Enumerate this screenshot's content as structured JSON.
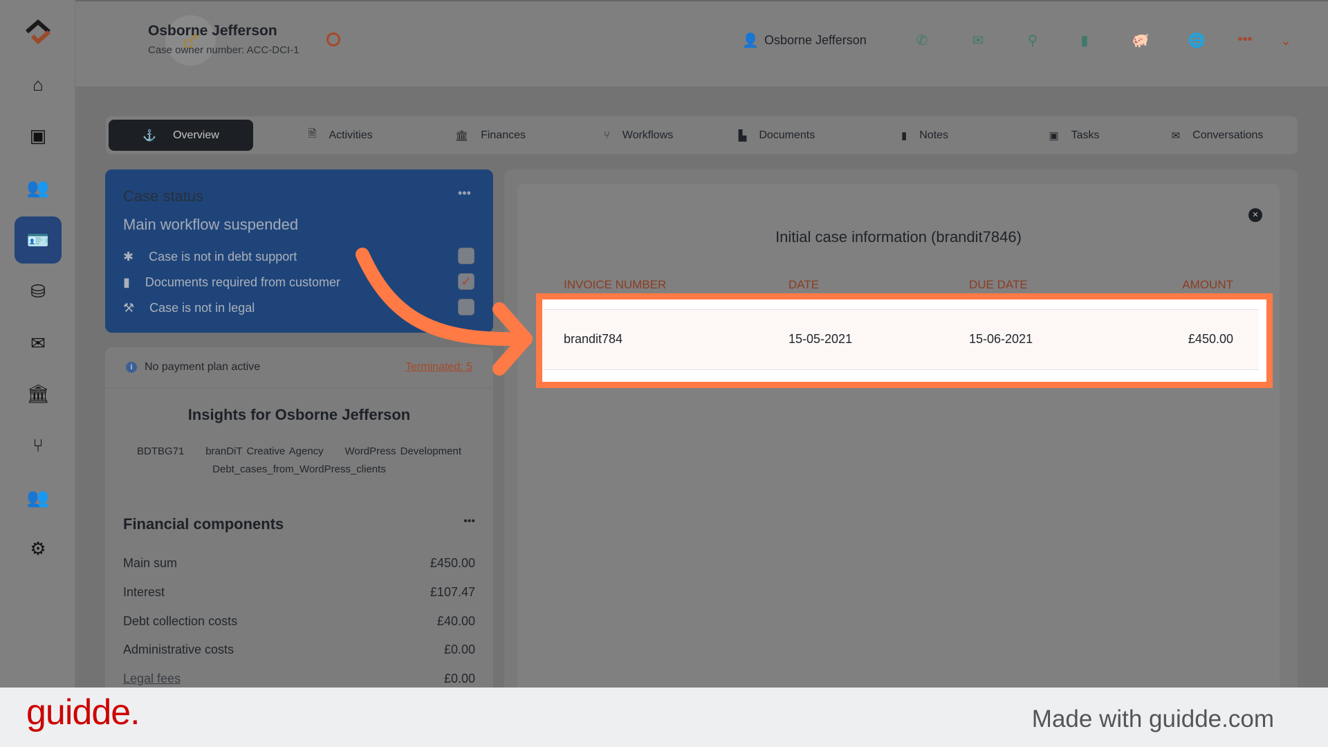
{
  "header": {
    "name": "Osborne Jefferson",
    "case_owner": "Case owner number: ACC-DCI-1",
    "contact_name": "Osborne Jefferson",
    "icons": [
      "phone-icon",
      "envelope-icon",
      "map-pin-icon",
      "mobile-icon",
      "piggy-bank-icon",
      "globe-icon",
      "more-icon",
      "chevron-down-icon"
    ]
  },
  "sidebar": {
    "items": [
      "logo",
      "home",
      "tasks",
      "users",
      "contact-card",
      "database",
      "mail",
      "bank",
      "workflow",
      "user-settings",
      "settings"
    ],
    "active": "contact-card"
  },
  "tabs": [
    {
      "label": "Overview",
      "icon": "anchor-icon"
    },
    {
      "label": "Activities",
      "icon": "file-search-icon"
    },
    {
      "label": "Finances",
      "icon": "bank-icon"
    },
    {
      "label": "Workflows",
      "icon": "branch-icon"
    },
    {
      "label": "Documents",
      "icon": "folder-icon"
    },
    {
      "label": "Notes",
      "icon": "clipboard-icon"
    },
    {
      "label": "Tasks",
      "icon": "ticket-icon"
    },
    {
      "label": "Conversations",
      "icon": "envelope-icon"
    }
  ],
  "case_status": {
    "title": "Case status",
    "subtitle": "Main workflow suspended",
    "items": [
      {
        "label": "Case is not in debt support",
        "checked": false
      },
      {
        "label": "Documents required from customer",
        "checked": true
      },
      {
        "label": "Case is not in legal",
        "checked": false
      }
    ]
  },
  "payment": {
    "text": "No payment plan active",
    "link": "Terminated: 5"
  },
  "insights": {
    "title": "Insights for Osborne Jefferson",
    "tags": [
      "BDTBG71",
      "branDiT Creative Agency",
      "WordPress Development",
      "Debt_cases_from_WordPress_clients"
    ]
  },
  "financial": {
    "title": "Financial components",
    "rows": [
      {
        "label": "Main sum",
        "value": "£450.00"
      },
      {
        "label": "Interest",
        "value": "£107.47"
      },
      {
        "label": "Debt collection costs",
        "value": "£40.00"
      },
      {
        "label": "Administrative costs",
        "value": "£0.00"
      },
      {
        "label": "Legal fees",
        "value": "£0.00"
      }
    ]
  },
  "modal": {
    "title": "Initial case information (brandit7846)",
    "columns": [
      "INVOICE NUMBER",
      "DATE",
      "DUE DATE",
      "AMOUNT"
    ],
    "rows": [
      [
        "brandit784",
        "15-05-2021",
        "15-06-2021",
        "£450.00"
      ]
    ]
  },
  "footer": {
    "logo": "guidde.",
    "tagline": "Made with guidde.com"
  },
  "colors": {
    "highlight": "#ff7a45",
    "brand_blue": "#1f4479",
    "guidde_red": "#cc0000"
  }
}
